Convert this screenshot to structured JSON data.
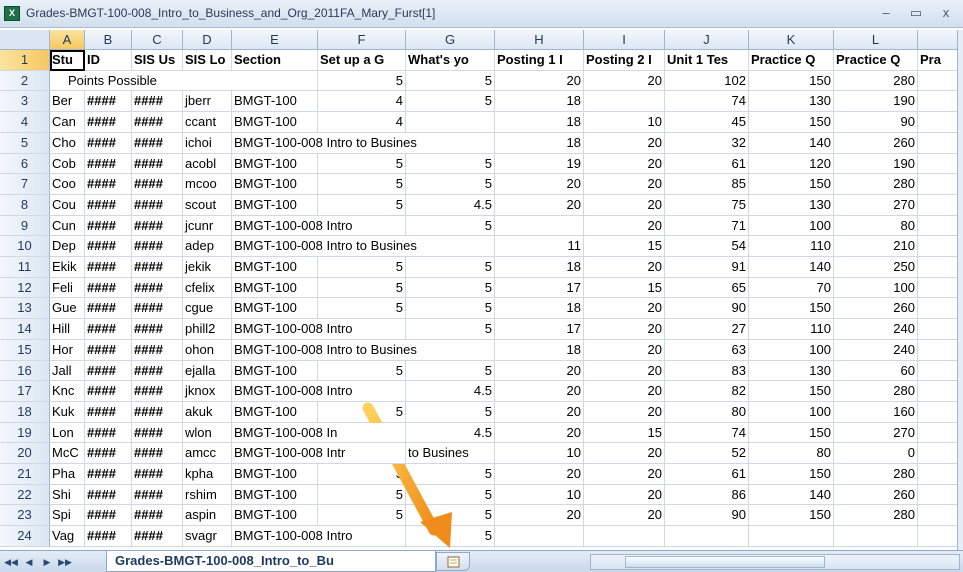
{
  "window": {
    "title": "Grades-BMGT-100-008_Intro_to_Business_and_Org_2011FA_Mary_Furst[1]",
    "minimize": "–",
    "restore": "▭",
    "close": "x",
    "icon": "excel-icon"
  },
  "columns": [
    "A",
    "B",
    "C",
    "D",
    "E",
    "F",
    "G",
    "H",
    "I",
    "J",
    "K",
    "L"
  ],
  "selected_column": "A",
  "rows": [
    {
      "n": "1",
      "cells": [
        "Stu",
        "ID",
        "SIS Us",
        "SIS Lo",
        "Section",
        "Set up a G",
        "What's yo",
        "Posting 1 I",
        "Posting 2 I",
        "Unit 1 Tes",
        "Practice Q",
        "Practice Q",
        "Pra"
      ]
    },
    {
      "n": "2",
      "cells": [
        "Points Possible",
        "",
        "",
        "",
        "",
        "5",
        "5",
        "20",
        "20",
        "102",
        "150",
        "280",
        ""
      ]
    },
    {
      "n": "3",
      "cells": [
        "Ber",
        "####",
        "####",
        "jberr",
        "BMGT-100",
        "4",
        "5",
        "18",
        "",
        "74",
        "130",
        "190",
        ""
      ]
    },
    {
      "n": "4",
      "cells": [
        "Can",
        "####",
        "####",
        "ccant",
        "BMGT-100",
        "4",
        "",
        "18",
        "10",
        "45",
        "150",
        "90",
        ""
      ]
    },
    {
      "n": "5",
      "cells": [
        "Cho",
        "####",
        "####",
        "ichoi",
        "BMGT-100-008 Intro to Busines",
        "",
        "",
        "18",
        "20",
        "32",
        "140",
        "260",
        ""
      ]
    },
    {
      "n": "6",
      "cells": [
        "Cob",
        "####",
        "####",
        "acobl",
        "BMGT-100",
        "5",
        "5",
        "19",
        "20",
        "61",
        "120",
        "190",
        ""
      ]
    },
    {
      "n": "7",
      "cells": [
        "Coo",
        "####",
        "####",
        "mcoo",
        "BMGT-100",
        "5",
        "5",
        "20",
        "20",
        "85",
        "150",
        "280",
        ""
      ]
    },
    {
      "n": "8",
      "cells": [
        "Cou",
        "####",
        "####",
        "scout",
        "BMGT-100",
        "5",
        "4.5",
        "20",
        "20",
        "75",
        "130",
        "270",
        ""
      ]
    },
    {
      "n": "9",
      "cells": [
        "Cun",
        "####",
        "####",
        "jcunr",
        "BMGT-100-008 Intro",
        "",
        "5",
        "",
        "20",
        "71",
        "100",
        "80",
        ""
      ]
    },
    {
      "n": "10",
      "cells": [
        "Dep",
        "####",
        "####",
        "adep",
        "BMGT-100-008 Intro to Busines",
        "",
        "",
        "11",
        "15",
        "54",
        "110",
        "210",
        ""
      ]
    },
    {
      "n": "11",
      "cells": [
        "Ekik",
        "####",
        "####",
        "jekik",
        "BMGT-100",
        "5",
        "5",
        "18",
        "20",
        "91",
        "140",
        "250",
        ""
      ]
    },
    {
      "n": "12",
      "cells": [
        "Feli",
        "####",
        "####",
        "cfelix",
        "BMGT-100",
        "5",
        "5",
        "17",
        "15",
        "65",
        "70",
        "100",
        ""
      ]
    },
    {
      "n": "13",
      "cells": [
        "Gue",
        "####",
        "####",
        "cgue",
        "BMGT-100",
        "5",
        "5",
        "18",
        "20",
        "90",
        "150",
        "260",
        ""
      ]
    },
    {
      "n": "14",
      "cells": [
        "Hill",
        "####",
        "####",
        "phill2",
        "BMGT-100-008 Intro",
        "",
        "5",
        "17",
        "20",
        "27",
        "110",
        "240",
        ""
      ]
    },
    {
      "n": "15",
      "cells": [
        "Hor",
        "####",
        "####",
        "ohon",
        "BMGT-100-008 Intro to Busines",
        "",
        "",
        "18",
        "20",
        "63",
        "100",
        "240",
        ""
      ]
    },
    {
      "n": "16",
      "cells": [
        "Jall",
        "####",
        "####",
        "ejalla",
        "BMGT-100",
        "5",
        "5",
        "20",
        "20",
        "83",
        "130",
        "60",
        ""
      ]
    },
    {
      "n": "17",
      "cells": [
        "Knc",
        "####",
        "####",
        "jknox",
        "BMGT-100-008 Intro",
        "",
        "4.5",
        "20",
        "20",
        "82",
        "150",
        "280",
        ""
      ]
    },
    {
      "n": "18",
      "cells": [
        "Kuk",
        "####",
        "####",
        "akuk",
        "BMGT-100",
        "5",
        "5",
        "20",
        "20",
        "80",
        "100",
        "160",
        ""
      ]
    },
    {
      "n": "19",
      "cells": [
        "Lon",
        "####",
        "####",
        "wlon",
        "BMGT-100-008 In",
        "",
        "4.5",
        "20",
        "15",
        "74",
        "150",
        "270",
        ""
      ]
    },
    {
      "n": "20",
      "cells": [
        "McC",
        "####",
        "####",
        "amcc",
        "BMGT-100-008 Intr",
        "",
        "to Busines",
        "10",
        "20",
        "52",
        "80",
        "0",
        ""
      ]
    },
    {
      "n": "21",
      "cells": [
        "Pha",
        "####",
        "####",
        "kpha",
        "BMGT-100",
        "3",
        "5",
        "20",
        "20",
        "61",
        "150",
        "280",
        ""
      ]
    },
    {
      "n": "22",
      "cells": [
        "Shi",
        "####",
        "####",
        "rshim",
        "BMGT-100",
        "5",
        "5",
        "10",
        "20",
        "86",
        "140",
        "260",
        ""
      ]
    },
    {
      "n": "23",
      "cells": [
        "Spi",
        "####",
        "####",
        "aspin",
        "BMGT-100",
        "5",
        "5",
        "20",
        "20",
        "90",
        "150",
        "280",
        ""
      ]
    },
    {
      "n": "24",
      "cells": [
        "Vag",
        "####",
        "####",
        "svagr",
        "BMGT-100-008 Intro",
        "",
        "5",
        "",
        "",
        "",
        "",
        "",
        ""
      ]
    }
  ],
  "sheet_tab": {
    "label": "Grades-BMGT-100-008_Intro_to_Bu"
  },
  "nav": {
    "first": "◀◀",
    "prev": "◀",
    "next": "▶",
    "last": "▶▶"
  },
  "annotation": {
    "color": "#f4a11d",
    "target": "insert-worksheet-tab"
  }
}
